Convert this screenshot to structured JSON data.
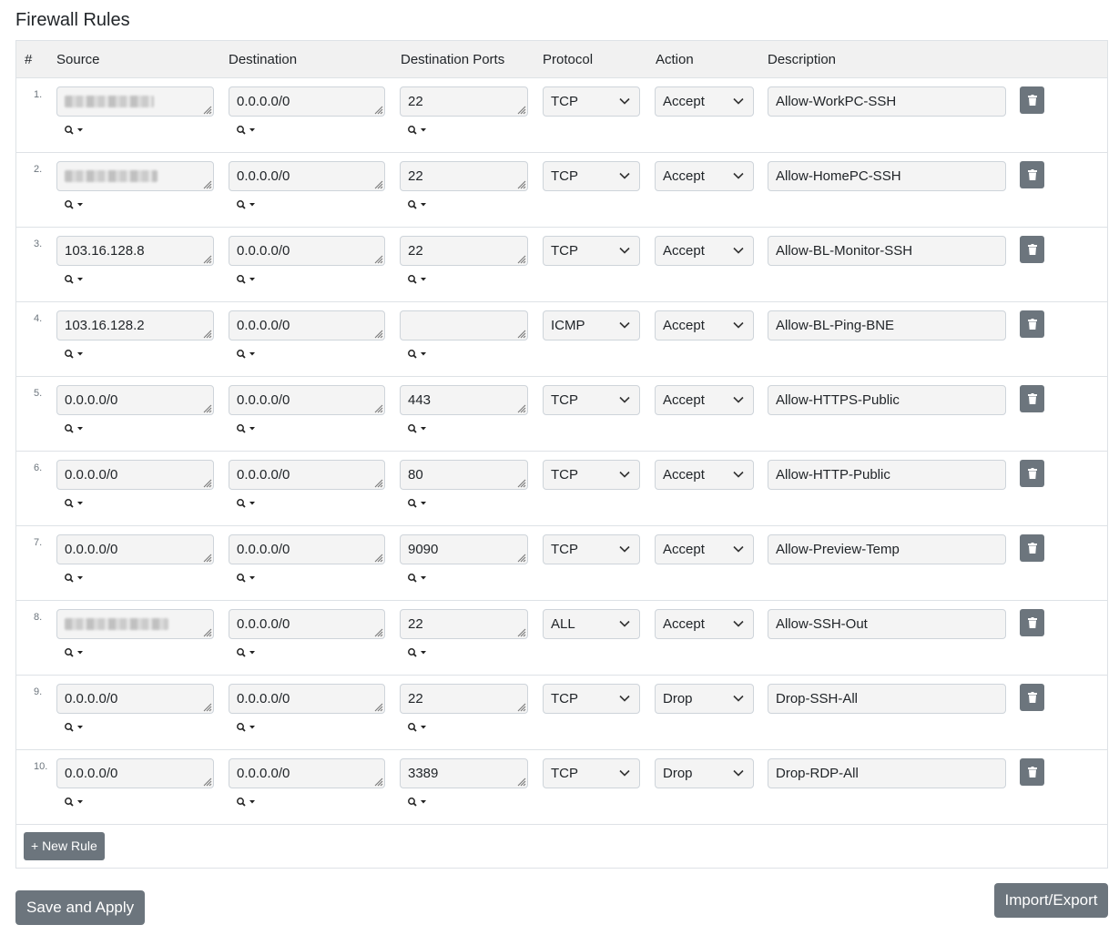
{
  "title": "Firewall Rules",
  "columns": [
    "#",
    "Source",
    "Destination",
    "Destination Ports",
    "Protocol",
    "Action",
    "Description"
  ],
  "rules": [
    {
      "num": "1.",
      "source": "",
      "source_redacted": true,
      "destination": "0.0.0.0/0",
      "ports": "22",
      "protocol": "TCP",
      "action": "Accept",
      "description": "Allow-WorkPC-SSH"
    },
    {
      "num": "2.",
      "source": "",
      "source_redacted": true,
      "destination": "0.0.0.0/0",
      "ports": "22",
      "protocol": "TCP",
      "action": "Accept",
      "description": "Allow-HomePC-SSH"
    },
    {
      "num": "3.",
      "source": "103.16.128.8",
      "destination": "0.0.0.0/0",
      "ports": "22",
      "protocol": "TCP",
      "action": "Accept",
      "description": "Allow-BL-Monitor-SSH"
    },
    {
      "num": "4.",
      "source": "103.16.128.2",
      "destination": "0.0.0.0/0",
      "ports": "",
      "protocol": "ICMP",
      "action": "Accept",
      "description": "Allow-BL-Ping-BNE"
    },
    {
      "num": "5.",
      "source": "0.0.0.0/0",
      "destination": "0.0.0.0/0",
      "ports": "443",
      "protocol": "TCP",
      "action": "Accept",
      "description": "Allow-HTTPS-Public"
    },
    {
      "num": "6.",
      "source": "0.0.0.0/0",
      "destination": "0.0.0.0/0",
      "ports": "80",
      "protocol": "TCP",
      "action": "Accept",
      "description": "Allow-HTTP-Public"
    },
    {
      "num": "7.",
      "source": "0.0.0.0/0",
      "destination": "0.0.0.0/0",
      "ports": "9090",
      "protocol": "TCP",
      "action": "Accept",
      "description": "Allow-Preview-Temp"
    },
    {
      "num": "8.",
      "source": "",
      "source_redacted": true,
      "destination": "0.0.0.0/0",
      "ports": "22",
      "protocol": "ALL",
      "action": "Accept",
      "description": "Allow-SSH-Out"
    },
    {
      "num": "9.",
      "source": "0.0.0.0/0",
      "destination": "0.0.0.0/0",
      "ports": "22",
      "protocol": "TCP",
      "action": "Drop",
      "description": "Drop-SSH-All"
    },
    {
      "num": "10.",
      "source": "0.0.0.0/0",
      "destination": "0.0.0.0/0",
      "ports": "3389",
      "protocol": "TCP",
      "action": "Drop",
      "description": "Drop-RDP-All"
    }
  ],
  "new_rule_label": "+ New Rule",
  "save_label": "Save and Apply",
  "import_export_label": "Import/Export",
  "icons": {
    "search": "search-icon",
    "dropdown": "caret-down-icon",
    "select": "chevron-down-icon",
    "delete": "trash-icon",
    "resize": "resize-grip-icon"
  },
  "colors": {
    "button": "#6c757d",
    "header_bg": "#f1f1f1",
    "input_bg": "#f4f4f4",
    "border": "#dee2e6"
  }
}
